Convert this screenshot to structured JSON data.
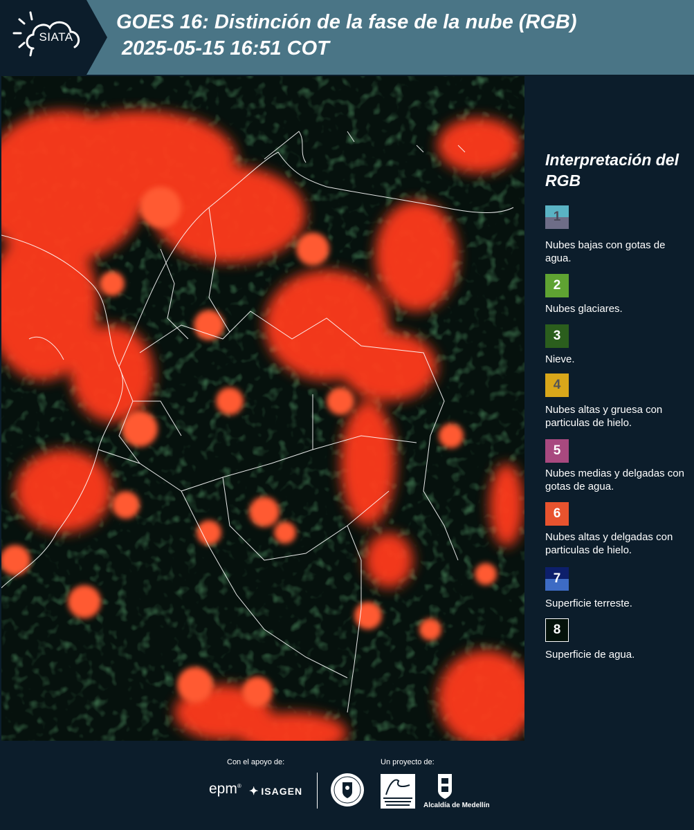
{
  "header": {
    "logo_text": "SIATA",
    "title_line1": "GOES 16: Distinción de la fase de la nube (RGB)",
    "title_line2": "2025-05-15 16:51 COT"
  },
  "legend": {
    "title": "Interpretación del RGB",
    "items": [
      {
        "num": "1",
        "label": "Nubes bajas con gotas de agua.",
        "color_top": "#5ab3c4",
        "color_bottom": "#6e6d87",
        "num_color": "#4a4a5a"
      },
      {
        "num": "2",
        "label": "Nubes glaciares.",
        "color_top": "#5fa332",
        "color_bottom": "#5fa332",
        "num_color": "#ffffff"
      },
      {
        "num": "3",
        "label": "Nieve.",
        "color_top": "#2b5e1d",
        "color_bottom": "#2b5e1d",
        "num_color": "#ffffff"
      },
      {
        "num": "4",
        "label": "Nubes altas y gruesa con particulas de hielo.",
        "color_top": "#d9a71a",
        "color_bottom": "#d9a71a",
        "num_color": "#555555"
      },
      {
        "num": "5",
        "label": "Nubes medias y delgadas con gotas de agua.",
        "color_top": "#a8497f",
        "color_bottom": "#a8497f",
        "num_color": "#ffffff"
      },
      {
        "num": "6",
        "label": "Nubes altas y delgadas con particulas de hielo.",
        "color_top": "#e8532e",
        "color_bottom": "#e8532e",
        "num_color": "#ffffff"
      },
      {
        "num": "7",
        "label": "Superficie terreste.",
        "color_top": "#0d1f6b",
        "color_bottom": "#3d6bc4",
        "num_color": "#ffffff"
      },
      {
        "num": "8",
        "label": "Superficie de agua.",
        "color_top": "#04120a",
        "color_bottom": "#04120a",
        "num_color": "#ffffff",
        "border": "#ffffff"
      }
    ]
  },
  "footer": {
    "support_label": "Con el apoyo de:",
    "project_label": "Un proyecto de:",
    "sponsors": [
      "epm",
      "ISAGEN"
    ],
    "partners": [
      "Área Metropolitana Valle de Aburrá",
      "Alcaldía de Medellín"
    ],
    "alcaldia_text": "Alcaldía de Medellín"
  },
  "colors": {
    "header_bg": "#4a7586",
    "panel_bg": "#0c1d2b",
    "cloud_red": "#ff3a1a",
    "cloud_orange": "#ff6a3a",
    "ground_dark": "#06110d"
  }
}
